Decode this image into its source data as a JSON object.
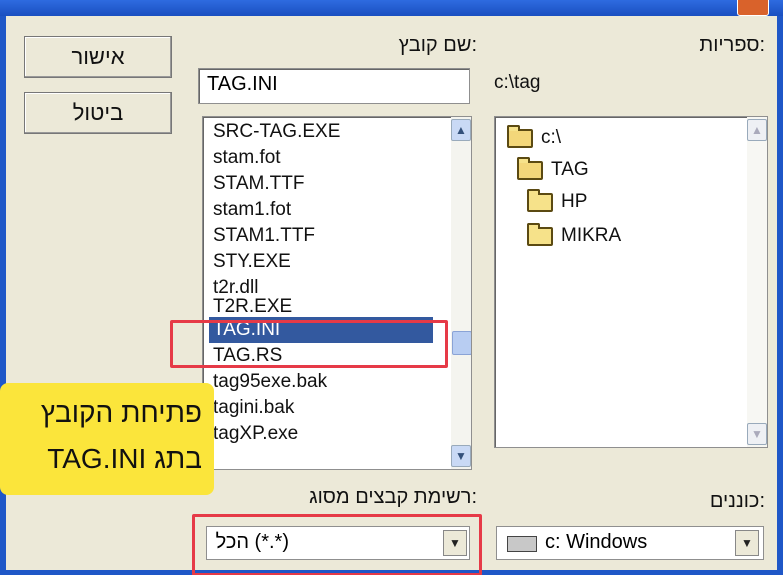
{
  "dialog": {
    "labels": {
      "filename": "שם קובץ:",
      "folders": "ספריות:",
      "file_types": "רשימת קבצים מסוג:",
      "drives": "כוננים:"
    },
    "buttons": {
      "ok": "אישור",
      "cancel": "ביטול"
    },
    "filename_value": "TAG.INI",
    "current_path": "c:\\tag",
    "files": [
      "SRC-TAG.EXE",
      "stam.fot",
      "STAM.TTF",
      "stam1.fot",
      "STAM1.TTF",
      "STY.EXE",
      "t2r.dll",
      "T2R.EXE",
      "TAG.INI",
      "TAG.RS",
      "tag95exe.bak",
      "tagini.bak",
      "tagXP.exe"
    ],
    "selected_file": "TAG.INI",
    "folders": [
      "c:\\",
      "TAG",
      "HP",
      "MIKRA"
    ],
    "file_type_value": "הכל (*.*)",
    "drive_value": "c: Windows"
  },
  "callout": {
    "line1": "פתיחת הקובץ",
    "line2": "TAG.INI בתג"
  },
  "colors": {
    "highlight": "#e63a47",
    "callout": "#fbe53b",
    "selection": "#33599f"
  }
}
